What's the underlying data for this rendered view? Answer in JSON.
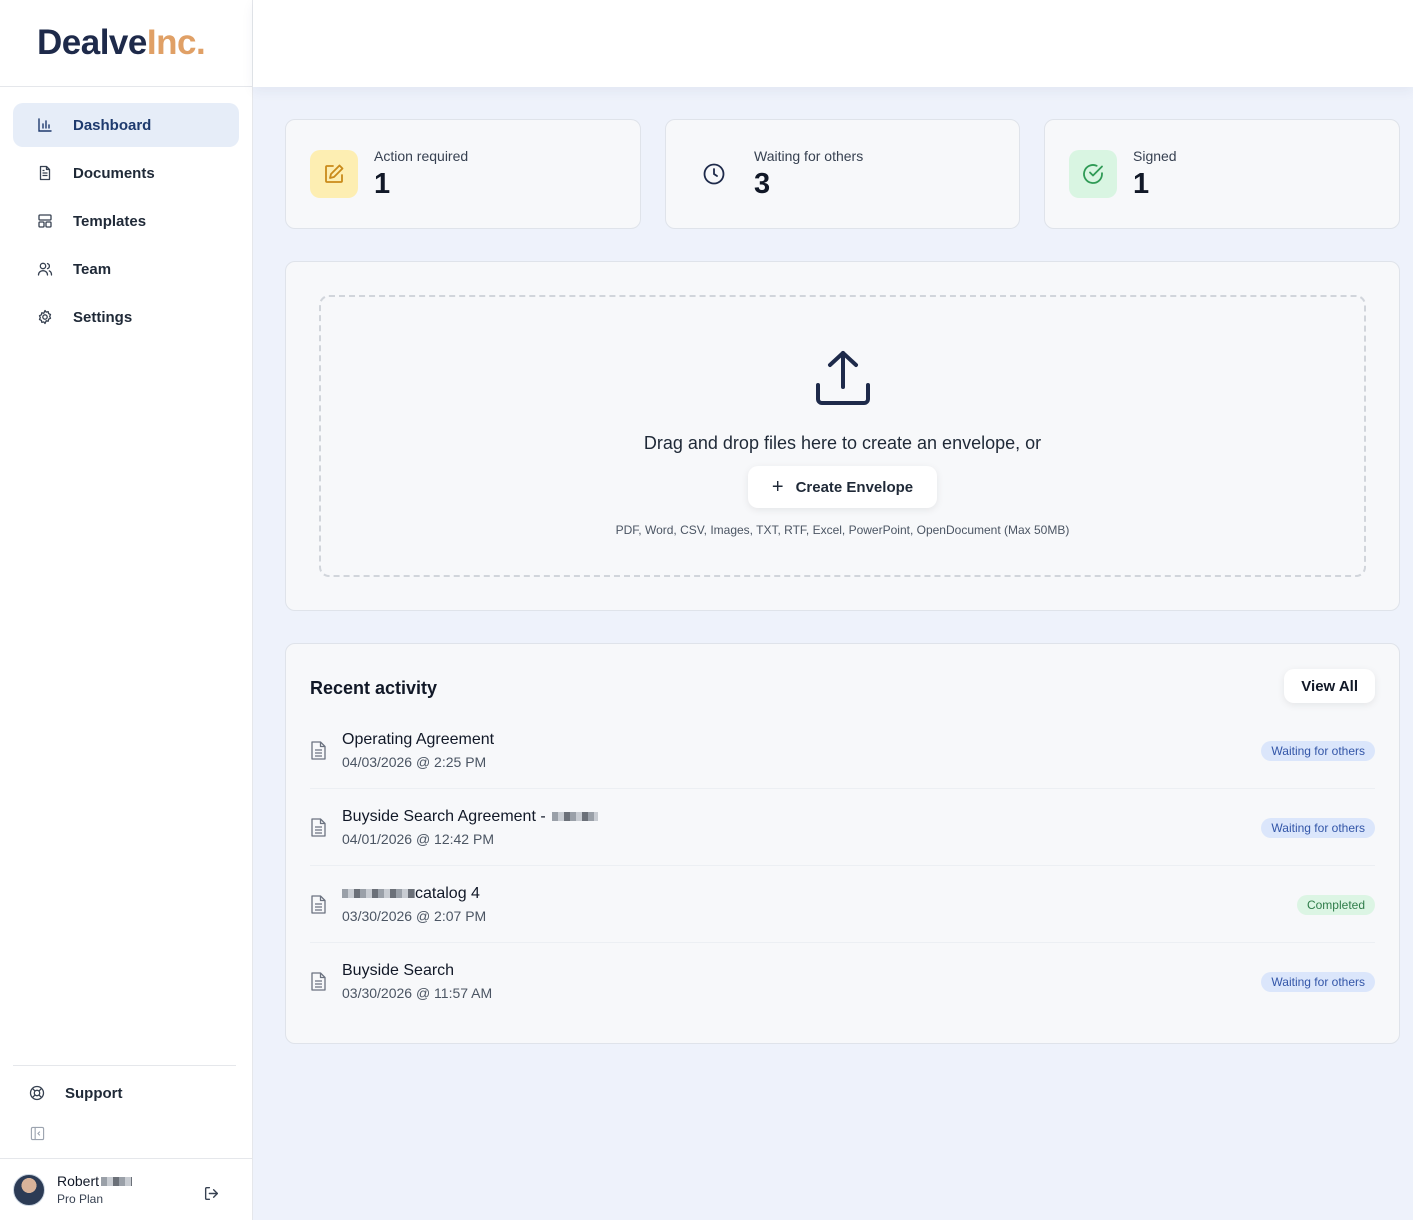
{
  "brand": {
    "part1": "Dealve",
    "part2": "Inc."
  },
  "nav": [
    {
      "label": "Dashboard",
      "icon": "bar-chart-icon",
      "active": true
    },
    {
      "label": "Documents",
      "icon": "document-icon",
      "active": false
    },
    {
      "label": "Templates",
      "icon": "template-icon",
      "active": false
    },
    {
      "label": "Team",
      "icon": "users-icon",
      "active": false
    },
    {
      "label": "Settings",
      "icon": "gear-icon",
      "active": false
    }
  ],
  "support": {
    "label": "Support"
  },
  "user": {
    "name": "Robert",
    "plan": "Pro Plan"
  },
  "stats": [
    {
      "label": "Action required",
      "value": "1",
      "icon": "edit-icon",
      "color": "#c98a1a",
      "bg": "#fdeeb2"
    },
    {
      "label": "Waiting for others",
      "value": "3",
      "icon": "clock-icon",
      "color": "#1e2a4a",
      "bg": "transparent"
    },
    {
      "label": "Signed",
      "value": "1",
      "icon": "check-circle-icon",
      "color": "#2f9a55",
      "bg": "#d9f5e2"
    }
  ],
  "upload": {
    "drop_text": "Drag and drop files here to create an envelope, or",
    "button_label": "Create Envelope",
    "formats": "PDF, Word, CSV, Images, TXT, RTF, Excel, PowerPoint, OpenDocument (Max 50MB)"
  },
  "activity": {
    "title": "Recent activity",
    "view_all": "View All",
    "items": [
      {
        "title": "Operating Agreement",
        "date": "04/03/2026 @ 2:25 PM",
        "status": "Waiting for others"
      },
      {
        "title": "Buyside Search Agreement -",
        "date": "04/01/2026 @ 12:42 PM",
        "status": "Waiting for others"
      },
      {
        "title": "catalog 4",
        "date": "03/30/2026 @ 2:07 PM",
        "status": "Completed"
      },
      {
        "title": "Buyside Search",
        "date": "03/30/2026 @ 11:57 AM",
        "status": "Waiting for others"
      }
    ]
  },
  "colors": {
    "accent": "#1e3a6e",
    "brand_orange": "#e0a066",
    "waiting": "#3356a8",
    "completed": "#2f7d4a"
  }
}
